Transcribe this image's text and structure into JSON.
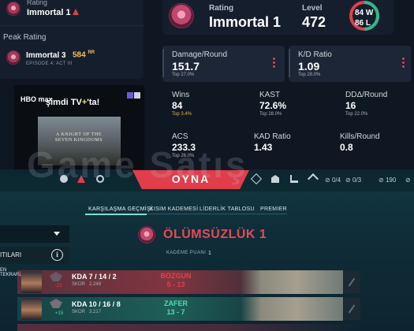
{
  "left_panel": {
    "rating_label": "Rating",
    "rating_value": "Immortal 1",
    "peak_title": "Peak Rating",
    "peak_value": "Immortal 3",
    "peak_rr": "584",
    "peak_rr_unit": "RR",
    "peak_episode": "EPISODE 4: ACT III"
  },
  "ad": {
    "brand": "HBO max",
    "text_prefix": "şimdi TV",
    "text_plus": "+",
    "text_suffix": "'ta!",
    "title": "A KNIGHT OF THE SEVEN KINGDOMS"
  },
  "main": {
    "rating_label": "Rating",
    "rating_value": "Immortal 1",
    "level_label": "Level",
    "level_value": "472",
    "wins_short": "84 W",
    "losses_short": "86 L",
    "colors": {
      "win": "#2fb98a",
      "loss": "#e0404a",
      "gold": "#e6b745"
    }
  },
  "cards": [
    {
      "title": "Damage/Round",
      "value": "151.7",
      "sub": "Top 27.0%"
    },
    {
      "title": "K/D Ratio",
      "value": "1.09",
      "sub": "Top 28.0%"
    }
  ],
  "stats": [
    {
      "title": "Wins",
      "value": "84",
      "sub": "Top 3.4%",
      "gold": true
    },
    {
      "title": "KAST",
      "value": "72.6%",
      "sub": "Top 28.0%",
      "gold": false
    },
    {
      "title": "DDΔ/Round",
      "value": "16",
      "sub": "Top 22.0%",
      "gold": false
    },
    {
      "title": "ACS",
      "value": "233.3",
      "sub": "Top 26.0%",
      "gold": false
    },
    {
      "title": "KAD Ratio",
      "value": "1.43",
      "sub": "",
      "gold": false
    },
    {
      "title": "Kills/Round",
      "value": "0.8",
      "sub": "",
      "gold": false
    }
  ],
  "watermark": "Game Satış",
  "client": {
    "play_button": "OYNA",
    "stat_a": "0/4",
    "stat_b": "0/3",
    "currency": "190",
    "tabs": [
      "KARŞILAŞMA GEÇMİŞİ",
      "KISIM KADEMESİ",
      "LİDERLİK TABLOSU",
      "PREMIER"
    ],
    "rank_title": "ÖLÜMSÜZLÜK 1",
    "kademe_label": "KADEME PUANI",
    "kademe_value": "1",
    "side_row_text": "ITILARI",
    "side_row2_text": "EN TEKRARLARI"
  },
  "matches": [
    {
      "kda": "KDA 7 / 14 / 2",
      "skor_label": "SKOR",
      "skor": "2.249",
      "result": "BOZGUN",
      "score": "5 - 13",
      "delta": "-21",
      "result_color": "#e0404a"
    },
    {
      "kda": "KDA 10 / 16 / 8",
      "skor_label": "SKOR",
      "skor": "3.217",
      "result": "ZAFER",
      "score": "13 - 7",
      "delta": "+15",
      "result_color": "#49e0b0"
    }
  ]
}
